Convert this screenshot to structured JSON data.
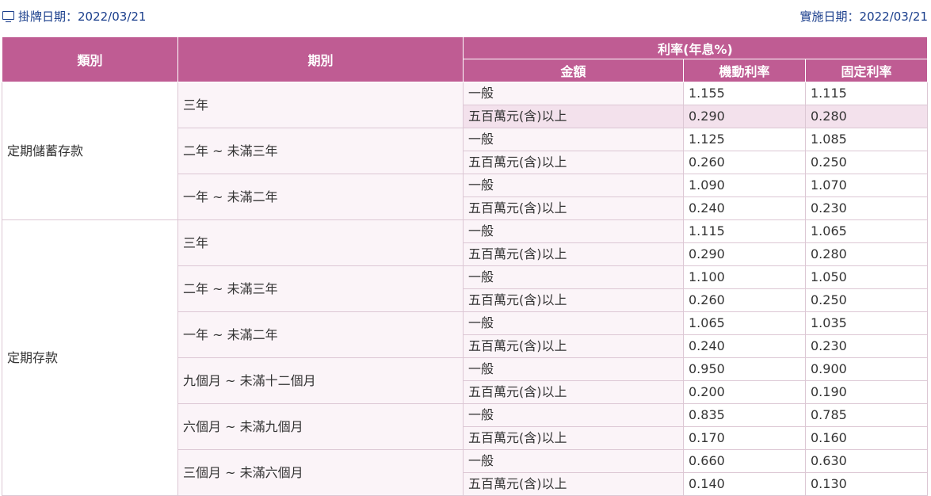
{
  "header": {
    "listing_date_label": "掛牌日期：2022/03/21",
    "effective_date_label": "實施日期：2022/03/21"
  },
  "table": {
    "col_category": "類別",
    "col_period": "期別",
    "col_rate_group": "利率(年息%)",
    "col_amount": "金額",
    "col_floating": "機動利率",
    "col_fixed": "固定利率",
    "groups": [
      {
        "category": "定期儲蓄存款",
        "periods": [
          {
            "period": "三年",
            "rows": [
              {
                "amount": "一般",
                "floating": "1.155",
                "fixed": "1.115"
              },
              {
                "amount": "五百萬元(含)以上",
                "floating": "0.290",
                "fixed": "0.280",
                "highlight": true
              }
            ]
          },
          {
            "period": "二年 ~ 未滿三年",
            "rows": [
              {
                "amount": "一般",
                "floating": "1.125",
                "fixed": "1.085"
              },
              {
                "amount": "五百萬元(含)以上",
                "floating": "0.260",
                "fixed": "0.250"
              }
            ]
          },
          {
            "period": "一年 ~ 未滿二年",
            "rows": [
              {
                "amount": "一般",
                "floating": "1.090",
                "fixed": "1.070"
              },
              {
                "amount": "五百萬元(含)以上",
                "floating": "0.240",
                "fixed": "0.230"
              }
            ]
          }
        ]
      },
      {
        "category": "定期存款",
        "periods": [
          {
            "period": "三年",
            "rows": [
              {
                "amount": "一般",
                "floating": "1.115",
                "fixed": "1.065"
              },
              {
                "amount": "五百萬元(含)以上",
                "floating": "0.290",
                "fixed": "0.280"
              }
            ]
          },
          {
            "period": "二年 ~ 未滿三年",
            "rows": [
              {
                "amount": "一般",
                "floating": "1.100",
                "fixed": "1.050"
              },
              {
                "amount": "五百萬元(含)以上",
                "floating": "0.260",
                "fixed": "0.250"
              }
            ]
          },
          {
            "period": "一年 ~ 未滿二年",
            "rows": [
              {
                "amount": "一般",
                "floating": "1.065",
                "fixed": "1.035"
              },
              {
                "amount": "五百萬元(含)以上",
                "floating": "0.240",
                "fixed": "0.230"
              }
            ]
          },
          {
            "period": "九個月 ~ 未滿十二個月",
            "rows": [
              {
                "amount": "一般",
                "floating": "0.950",
                "fixed": "0.900"
              },
              {
                "amount": "五百萬元(含)以上",
                "floating": "0.200",
                "fixed": "0.190"
              }
            ]
          },
          {
            "period": "六個月 ~ 未滿九個月",
            "rows": [
              {
                "amount": "一般",
                "floating": "0.835",
                "fixed": "0.785"
              },
              {
                "amount": "五百萬元(含)以上",
                "floating": "0.170",
                "fixed": "0.160"
              }
            ]
          },
          {
            "period": "三個月 ~ 未滿六個月",
            "rows": [
              {
                "amount": "一般",
                "floating": "0.660",
                "fixed": "0.630"
              },
              {
                "amount": "五百萬元(含)以上",
                "floating": "0.140",
                "fixed": "0.130"
              }
            ]
          }
        ]
      }
    ]
  }
}
